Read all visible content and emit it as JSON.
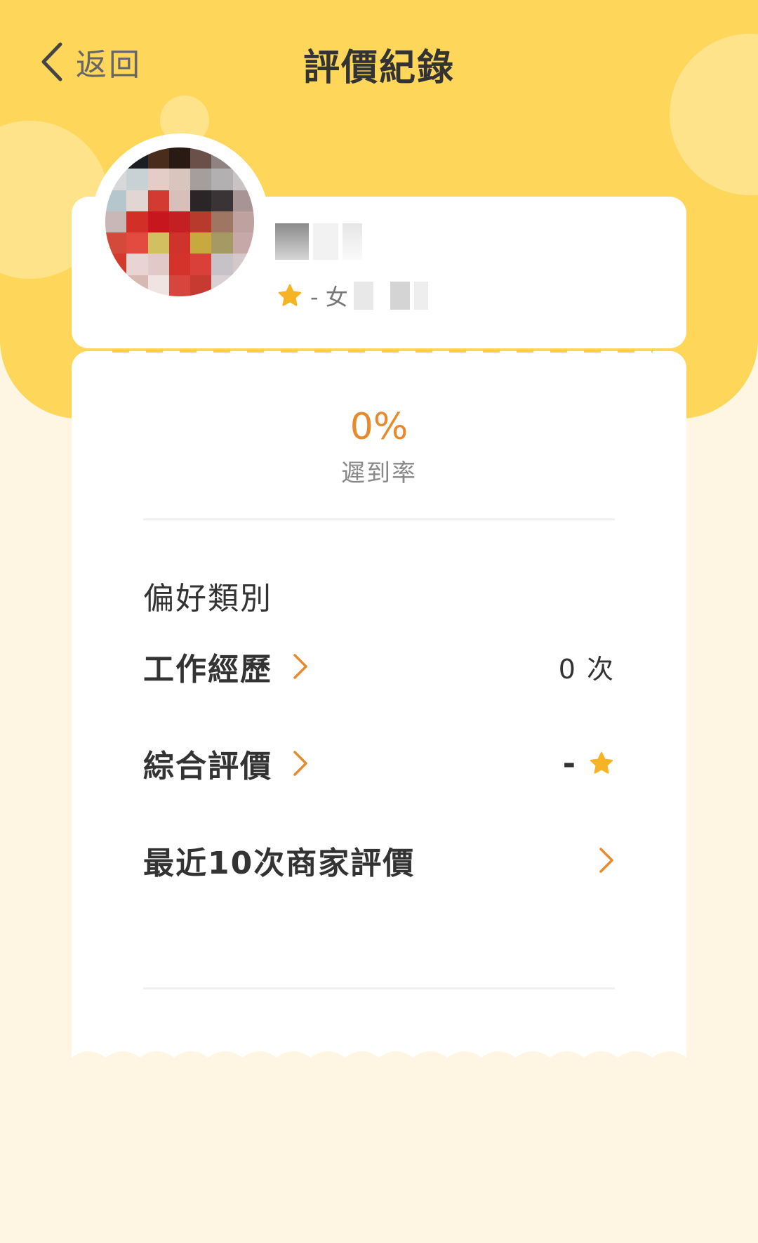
{
  "header": {
    "back_label": "返回",
    "title": "評價紀錄"
  },
  "profile": {
    "sub_text": "- 女"
  },
  "stats": {
    "late_rate_value": "0%",
    "late_rate_label": "遲到率"
  },
  "section": {
    "title": "偏好類別",
    "rows": [
      {
        "label": "工作經歷",
        "value": "0 次"
      },
      {
        "label": "綜合評價",
        "value": "-"
      },
      {
        "label": "最近10次商家評價"
      }
    ]
  },
  "colors": {
    "header_yellow": "#FDD65A",
    "page_background": "#FEF6E2",
    "accent_orange": "#E8892B",
    "star_yellow": "#F6B425",
    "dash_yellow": "#FBCB43"
  },
  "icons": {
    "back": "chevron-left-icon",
    "star": "star-icon",
    "chevron": "chevron-right-icon"
  }
}
